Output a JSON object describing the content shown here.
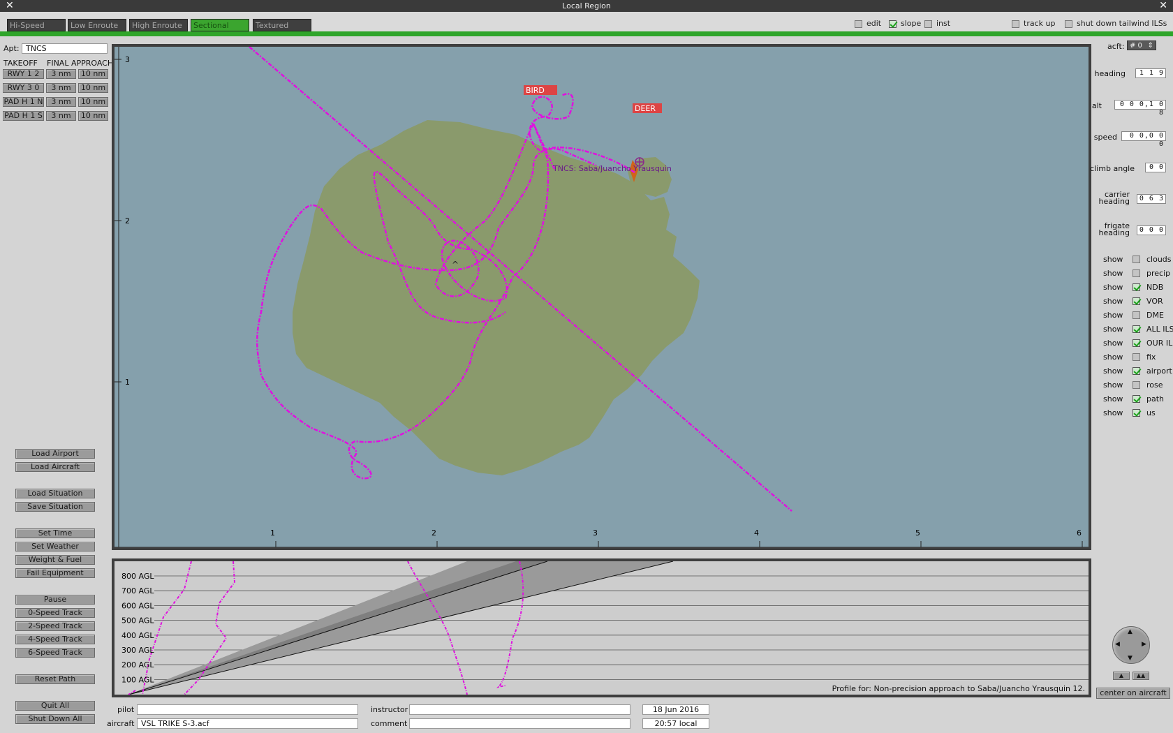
{
  "window": {
    "title": "Local Region",
    "close_left": "✕",
    "close_right": "✕"
  },
  "tabs": [
    {
      "label": "Hi-Speed"
    },
    {
      "label": "Low Enroute"
    },
    {
      "label": "High Enroute"
    },
    {
      "label": "Sectional",
      "active": true
    },
    {
      "label": "Textured"
    }
  ],
  "top_options": [
    {
      "label": "edit",
      "checked": false
    },
    {
      "label": "slope",
      "checked": true
    },
    {
      "label": "inst",
      "checked": false
    },
    {
      "label": "track up",
      "checked": false
    },
    {
      "label": "shut down tailwind ILSs",
      "checked": false
    }
  ],
  "airport": {
    "label": "Apt:",
    "value": "TNCS"
  },
  "runway_headers": {
    "takeoff": "TAKEOFF",
    "final": "FINAL APPROACH"
  },
  "runways": [
    {
      "name": "RWY 1 2",
      "a": "3 nm",
      "b": "10 nm"
    },
    {
      "name": "RWY 3 0",
      "a": "3 nm",
      "b": "10 nm"
    },
    {
      "name": "PAD H 1 N",
      "a": "3 nm",
      "b": "10 nm"
    },
    {
      "name": "PAD H 1 S",
      "a": "3 nm",
      "b": "10 nm"
    }
  ],
  "left_buttons": [
    "Load Airport",
    "Load Aircraft",
    "Load Situation",
    "Save Situation",
    "Set Time",
    "Set Weather",
    "Weight & Fuel",
    "Fail Equipment",
    "Pause",
    "0-Speed Track",
    "2-Speed Track",
    "4-Speed Track",
    "6-Speed Track",
    "Reset Path",
    "Quit All",
    "Shut Down All"
  ],
  "map": {
    "x_ticks": [
      "1",
      "2",
      "3",
      "4",
      "5",
      "6"
    ],
    "y_ticks": [
      "3",
      "2",
      "1"
    ],
    "fix_labels": [
      "BIRD",
      "DEER"
    ],
    "airport_label": "TNCS: Saba/Juancho Yrausquin",
    "aircraft_marker": "^",
    "colors": {
      "sea": "#85a0ac",
      "land": "#8a9a6c",
      "path": "#e010e0",
      "runway": "#d0641a"
    }
  },
  "profile": {
    "y_ticks": [
      "800 AGL",
      "700 AGL",
      "600 AGL",
      "500 AGL",
      "400 AGL",
      "300 AGL",
      "200 AGL",
      "100 AGL"
    ],
    "caption": "Profile for: Non-precision approach to Saba/Juancho Yrausquin 12."
  },
  "right": {
    "acft_label": "acft:",
    "acft_value": "# 0",
    "heading_label": "heading",
    "heading_value": "1 1 9",
    "alt_label": "alt",
    "alt_value": "0 0 0,1 0 8",
    "speed_label": "speed",
    "speed_value": "0 0,0 0 0",
    "climb_label": "climb angle",
    "climb_value": "0 0",
    "carrier_label": "carrier heading",
    "carrier_value": "0 6 3",
    "frigate_label": "frigate heading",
    "frigate_value": "0 0 0",
    "show_label": "show",
    "shows": [
      {
        "name": "clouds",
        "checked": false
      },
      {
        "name": "precip",
        "checked": false
      },
      {
        "name": "NDB",
        "checked": true
      },
      {
        "name": "VOR",
        "checked": true
      },
      {
        "name": "DME",
        "checked": false
      },
      {
        "name": "ALL ILS",
        "checked": true
      },
      {
        "name": "OUR ILS",
        "checked": true
      },
      {
        "name": "fix",
        "checked": false
      },
      {
        "name": "airport",
        "checked": true
      },
      {
        "name": "rose",
        "checked": false
      },
      {
        "name": "path",
        "checked": true
      },
      {
        "name": "us",
        "checked": true
      }
    ],
    "center_label": "center on aircraft"
  },
  "bottom": {
    "pilot_label": "pilot",
    "pilot_value": "",
    "aircraft_label": "aircraft",
    "aircraft_value": "VSL TRIKE S-3.acf",
    "instructor_label": "instructor",
    "instructor_value": "",
    "comment_label": "comment",
    "comment_value": "",
    "date": "18 Jun  2016",
    "time": "20:57 local"
  }
}
